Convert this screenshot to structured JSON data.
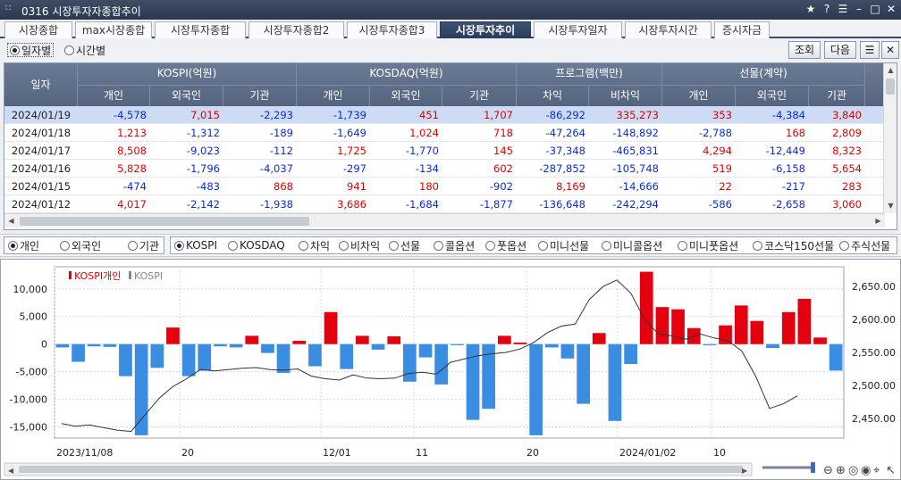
{
  "window": {
    "title": "0316 시장투자자종합추이"
  },
  "tabs": [
    "시장종합",
    "max시장종합",
    "시장투자종합",
    "시장투자종합2",
    "시장투자종합3",
    "시장투자추이",
    "시장투자일자",
    "시장투자시간",
    "증시자금"
  ],
  "active_tab": 5,
  "toolbar": {
    "radio_date": "일자별",
    "radio_time": "시간별",
    "btn_query": "조회",
    "btn_next": "다음"
  },
  "grid": {
    "header_date": "일자",
    "groups": [
      "KOSPI(억원)",
      "KOSDAQ(억원)",
      "프로그램(백만)",
      "선물(계약)"
    ],
    "subcols": [
      "개인",
      "외국인",
      "기관",
      "개인",
      "외국인",
      "기관",
      "차익",
      "비차익",
      "개인",
      "외국인",
      "기관"
    ],
    "rows": [
      {
        "date": "2024/01/19",
        "cells": [
          "-4,578",
          "7,015",
          "-2,293",
          "-1,739",
          "451",
          "1,707",
          "-86,292",
          "335,273",
          "353",
          "-4,384",
          "3,840"
        ]
      },
      {
        "date": "2024/01/18",
        "cells": [
          "1,213",
          "-1,312",
          "-189",
          "-1,649",
          "1,024",
          "718",
          "-47,264",
          "-148,892",
          "-2,788",
          "168",
          "2,809"
        ]
      },
      {
        "date": "2024/01/17",
        "cells": [
          "8,508",
          "-9,023",
          "-112",
          "1,725",
          "-1,770",
          "145",
          "-37,348",
          "-465,831",
          "4,294",
          "-12,449",
          "8,323"
        ]
      },
      {
        "date": "2024/01/16",
        "cells": [
          "5,828",
          "-1,796",
          "-4,037",
          "-297",
          "-134",
          "602",
          "-287,852",
          "-105,748",
          "519",
          "-6,158",
          "5,654"
        ]
      },
      {
        "date": "2024/01/15",
        "cells": [
          "-474",
          "-483",
          "868",
          "941",
          "180",
          "-902",
          "8,169",
          "-14,666",
          "22",
          "-217",
          "283"
        ]
      },
      {
        "date": "2024/01/12",
        "cells": [
          "4,017",
          "-2,142",
          "-1,938",
          "3,686",
          "-1,684",
          "-1,877",
          "-136,648",
          "-242,294",
          "-586",
          "-2,658",
          "3,060"
        ]
      }
    ]
  },
  "investor_options": [
    "개인",
    "외국인",
    "기관"
  ],
  "investor_selected": 0,
  "market_options": [
    "KOSPI",
    "KOSDAQ",
    "차익",
    "비차익",
    "선물",
    "콜옵션",
    "풋옵션",
    "미니선물",
    "미니콜옵션",
    "미니풋옵션",
    "코스닥150선물",
    "주식선물"
  ],
  "market_selected": 0,
  "colors": {
    "positive": "#e00000",
    "negative": "#0a2be0",
    "bar_pos": "#e3000f",
    "bar_neg": "#3a8de0",
    "line": "#333333",
    "header": "#5f6e88",
    "tab_active": "#2f4264"
  },
  "chart_data": {
    "type": "bar",
    "legend": [
      "KOSPI개인",
      "KOSPI"
    ],
    "x_labels": [
      "2023/11/08",
      "20",
      "12/01",
      "11",
      "20",
      "2024/01/02",
      "10"
    ],
    "y_left_ticks": [
      "10,000",
      "5,000",
      "0",
      "-5,000",
      "-10,000",
      "-15,000"
    ],
    "y_right_ticks": [
      "2,650.00",
      "2,600.00",
      "2,550.00",
      "2,500.00",
      "2,450.00"
    ],
    "y_left_range": [
      -17000,
      14000
    ],
    "y_right_range": [
      2420,
      2680
    ],
    "series": [
      {
        "name": "KOSPI개인",
        "values": [
          -600,
          -3200,
          -400,
          -500,
          -5800,
          -16500,
          -4300,
          3000,
          -5800,
          -4800,
          -400,
          -600,
          1500,
          -1600,
          -5200,
          600,
          -4000,
          5800,
          -4500,
          1500,
          -1000,
          1400,
          -6800,
          -2400,
          -7300,
          -200,
          -13700,
          -11700,
          1500,
          300,
          -16500,
          -600,
          -2600,
          -10800,
          2000,
          -13900,
          -3600,
          13100,
          6700,
          6300,
          2900,
          -200,
          3400,
          7000,
          4200,
          -700,
          5800,
          8200,
          1200,
          -4800
        ]
      },
      {
        "name": "KOSPI",
        "values": [
          2442,
          2438,
          2440,
          2436,
          2432,
          2430,
          2455,
          2480,
          2498,
          2510,
          2524,
          2522,
          2524,
          2526,
          2527,
          2524,
          2523,
          2525,
          2514,
          2510,
          2508,
          2516,
          2511,
          2510,
          2511,
          2518,
          2520,
          2517,
          2535,
          2540,
          2545,
          2548,
          2550,
          2555,
          2565,
          2580,
          2590,
          2593,
          2630,
          2650,
          2660,
          2640,
          2600,
          2578,
          2575,
          2570,
          2578,
          2572,
          2568,
          2552,
          2514,
          2465,
          2472,
          2484
        ]
      }
    ]
  }
}
